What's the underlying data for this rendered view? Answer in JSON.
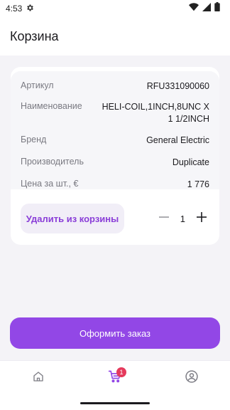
{
  "status_bar": {
    "time": "4:53"
  },
  "header": {
    "title": "Корзина"
  },
  "product": {
    "specs": [
      {
        "label": "Артикул",
        "value": "RFU331090060"
      },
      {
        "label": "Наименование",
        "value": "HELI-COIL,1INCH,8UNC X 1 1/2INCH"
      },
      {
        "label": "Бренд",
        "value": "General Electric"
      },
      {
        "label": "Производитель",
        "value": "Duplicate"
      },
      {
        "label": "Цена за шт., €",
        "value": "1 776"
      }
    ],
    "remove_label": "Удалить из корзины",
    "quantity": "1"
  },
  "checkout": {
    "label": "Оформить заказ"
  },
  "bottom_nav": {
    "items": [
      {
        "icon": "home-icon"
      },
      {
        "icon": "cart-icon",
        "badge": "1",
        "active": true
      },
      {
        "icon": "profile-icon"
      }
    ]
  },
  "colors": {
    "accent": "#9247e6",
    "badge": "#e53a5c",
    "accent_text": "#8a3ed8"
  }
}
